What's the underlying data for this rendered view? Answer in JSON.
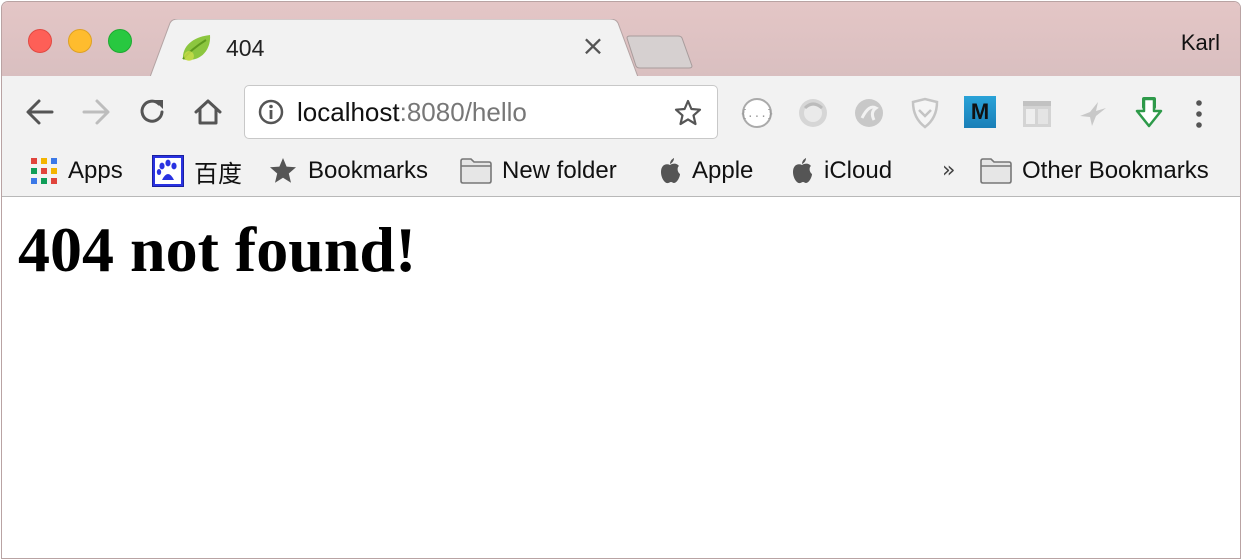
{
  "window": {
    "profile_name": "Karl"
  },
  "tab": {
    "title": "404",
    "favicon": "spring-leaf-icon",
    "close_glyph": "×"
  },
  "toolbar": {
    "url_host": "localhost",
    "url_rest": ":8080/hello",
    "icons": [
      "back-arrow-icon",
      "forward-arrow-icon",
      "reload-icon",
      "home-icon",
      "info-icon",
      "star-icon"
    ],
    "extensions": [
      {
        "name": "json-viewer-extension-icon"
      },
      {
        "name": "grey-circle-extension-icon"
      },
      {
        "name": "grey-swirl-extension-icon"
      },
      {
        "name": "shield-extension-icon"
      },
      {
        "name": "m-extension-icon",
        "label": "M"
      },
      {
        "name": "reader-layout-extension-icon"
      },
      {
        "name": "hummingbird-extension-icon"
      },
      {
        "name": "download-extension-icon"
      }
    ]
  },
  "bookmarks": {
    "items": [
      {
        "label": "Apps",
        "icon": "apps-grid-icon"
      },
      {
        "label": "百度",
        "icon": "baidu-paw-icon"
      },
      {
        "label": "Bookmarks",
        "icon": "star-icon"
      },
      {
        "label": "New folder",
        "icon": "folder-icon"
      },
      {
        "label": "Apple",
        "icon": "apple-icon"
      },
      {
        "label": "iCloud",
        "icon": "apple-icon"
      }
    ],
    "overflow_glyph": "»",
    "other": {
      "label": "Other Bookmarks",
      "icon": "folder-icon"
    }
  },
  "page": {
    "heading": "404 not found!"
  },
  "colors": {
    "titlebar": "#e0c3c4",
    "toolbar": "#f2f2f2",
    "close": "#fe5f57",
    "minimize": "#febc2e",
    "maximize": "#28c840",
    "spring_green": "#8cc63f"
  }
}
